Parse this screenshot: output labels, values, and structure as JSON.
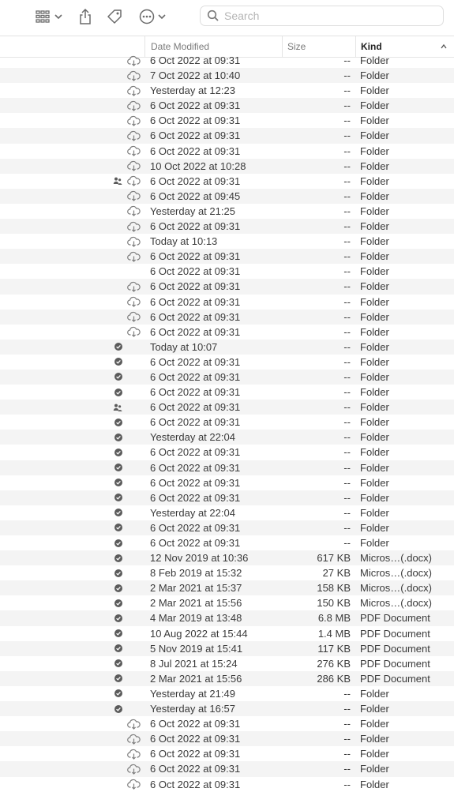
{
  "toolbar": {
    "search_placeholder": "Search",
    "buttons": [
      "view-options",
      "share",
      "tags",
      "more-actions"
    ]
  },
  "columns": {
    "date_modified": "Date Modified",
    "size": "Size",
    "kind": "Kind"
  },
  "rows": [
    {
      "date": "6 Oct 2022 at 09:31",
      "size": "--",
      "kind": "Folder",
      "icon": "cloud"
    },
    {
      "date": "7 Oct 2022 at 10:40",
      "size": "--",
      "kind": "Folder",
      "icon": "cloud"
    },
    {
      "date": "Yesterday at 12:23",
      "size": "--",
      "kind": "Folder",
      "icon": "cloud"
    },
    {
      "date": "6 Oct 2022 at 09:31",
      "size": "--",
      "kind": "Folder",
      "icon": "cloud"
    },
    {
      "date": "6 Oct 2022 at 09:31",
      "size": "--",
      "kind": "Folder",
      "icon": "cloud"
    },
    {
      "date": "6 Oct 2022 at 09:31",
      "size": "--",
      "kind": "Folder",
      "icon": "cloud"
    },
    {
      "date": "6 Oct 2022 at 09:31",
      "size": "--",
      "kind": "Folder",
      "icon": "cloud"
    },
    {
      "date": "10 Oct 2022 at 10:28",
      "size": "--",
      "kind": "Folder",
      "icon": "cloud"
    },
    {
      "date": "6 Oct 2022 at 09:31",
      "size": "--",
      "kind": "Folder",
      "icon": "shared-cloud"
    },
    {
      "date": "6 Oct 2022 at 09:45",
      "size": "--",
      "kind": "Folder",
      "icon": "cloud"
    },
    {
      "date": "Yesterday at 21:25",
      "size": "--",
      "kind": "Folder",
      "icon": "cloud"
    },
    {
      "date": "6 Oct 2022 at 09:31",
      "size": "--",
      "kind": "Folder",
      "icon": "cloud"
    },
    {
      "date": "Today at 10:13",
      "size": "--",
      "kind": "Folder",
      "icon": "cloud"
    },
    {
      "date": "6 Oct 2022 at 09:31",
      "size": "--",
      "kind": "Folder",
      "icon": "cloud"
    },
    {
      "date": "6 Oct 2022 at 09:31",
      "size": "--",
      "kind": "Folder",
      "icon": "none"
    },
    {
      "date": "6 Oct 2022 at 09:31",
      "size": "--",
      "kind": "Folder",
      "icon": "cloud"
    },
    {
      "date": "6 Oct 2022 at 09:31",
      "size": "--",
      "kind": "Folder",
      "icon": "cloud"
    },
    {
      "date": "6 Oct 2022 at 09:31",
      "size": "--",
      "kind": "Folder",
      "icon": "cloud"
    },
    {
      "date": "6 Oct 2022 at 09:31",
      "size": "--",
      "kind": "Folder",
      "icon": "cloud"
    },
    {
      "date": "Today at 10:07",
      "size": "--",
      "kind": "Folder",
      "icon": "check"
    },
    {
      "date": "6 Oct 2022 at 09:31",
      "size": "--",
      "kind": "Folder",
      "icon": "check"
    },
    {
      "date": "6 Oct 2022 at 09:31",
      "size": "--",
      "kind": "Folder",
      "icon": "check"
    },
    {
      "date": "6 Oct 2022 at 09:31",
      "size": "--",
      "kind": "Folder",
      "icon": "check"
    },
    {
      "date": "6 Oct 2022 at 09:31",
      "size": "--",
      "kind": "Folder",
      "icon": "shared"
    },
    {
      "date": "6 Oct 2022 at 09:31",
      "size": "--",
      "kind": "Folder",
      "icon": "check"
    },
    {
      "date": "Yesterday at 22:04",
      "size": "--",
      "kind": "Folder",
      "icon": "check"
    },
    {
      "date": "6 Oct 2022 at 09:31",
      "size": "--",
      "kind": "Folder",
      "icon": "check"
    },
    {
      "date": "6 Oct 2022 at 09:31",
      "size": "--",
      "kind": "Folder",
      "icon": "check"
    },
    {
      "date": "6 Oct 2022 at 09:31",
      "size": "--",
      "kind": "Folder",
      "icon": "check"
    },
    {
      "date": "6 Oct 2022 at 09:31",
      "size": "--",
      "kind": "Folder",
      "icon": "check"
    },
    {
      "date": "Yesterday at 22:04",
      "size": "--",
      "kind": "Folder",
      "icon": "check"
    },
    {
      "date": "6 Oct 2022 at 09:31",
      "size": "--",
      "kind": "Folder",
      "icon": "check"
    },
    {
      "date": "6 Oct 2022 at 09:31",
      "size": "--",
      "kind": "Folder",
      "icon": "check"
    },
    {
      "date": "12 Nov 2019 at 10:36",
      "size": "617 KB",
      "kind": "Micros…(.docx)",
      "icon": "check"
    },
    {
      "date": "8 Feb 2019 at 15:32",
      "size": "27 KB",
      "kind": "Micros…(.docx)",
      "icon": "check"
    },
    {
      "date": "2 Mar 2021 at 15:37",
      "size": "158 KB",
      "kind": "Micros…(.docx)",
      "icon": "check"
    },
    {
      "date": "2 Mar 2021 at 15:56",
      "size": "150 KB",
      "kind": "Micros…(.docx)",
      "icon": "check"
    },
    {
      "date": "4 Mar 2019 at 13:48",
      "size": "6.8 MB",
      "kind": "PDF Document",
      "icon": "check"
    },
    {
      "date": "10 Aug 2022 at 15:44",
      "size": "1.4 MB",
      "kind": "PDF Document",
      "icon": "check"
    },
    {
      "date": "5 Nov 2019 at 15:41",
      "size": "117 KB",
      "kind": "PDF Document",
      "icon": "check"
    },
    {
      "date": "8 Jul 2021 at 15:24",
      "size": "276 KB",
      "kind": "PDF Document",
      "icon": "check"
    },
    {
      "date": "2 Mar 2021 at 15:56",
      "size": "286 KB",
      "kind": "PDF Document",
      "icon": "check"
    },
    {
      "date": "Yesterday at 21:49",
      "size": "--",
      "kind": "Folder",
      "icon": "check"
    },
    {
      "date": "Yesterday at 16:57",
      "size": "--",
      "kind": "Folder",
      "icon": "check"
    },
    {
      "date": "6 Oct 2022 at 09:31",
      "size": "--",
      "kind": "Folder",
      "icon": "cloud"
    },
    {
      "date": "6 Oct 2022 at 09:31",
      "size": "--",
      "kind": "Folder",
      "icon": "cloud"
    },
    {
      "date": "6 Oct 2022 at 09:31",
      "size": "--",
      "kind": "Folder",
      "icon": "cloud"
    },
    {
      "date": "6 Oct 2022 at 09:31",
      "size": "--",
      "kind": "Folder",
      "icon": "cloud"
    },
    {
      "date": "6 Oct 2022 at 09:31",
      "size": "--",
      "kind": "Folder",
      "icon": "cloud"
    }
  ]
}
